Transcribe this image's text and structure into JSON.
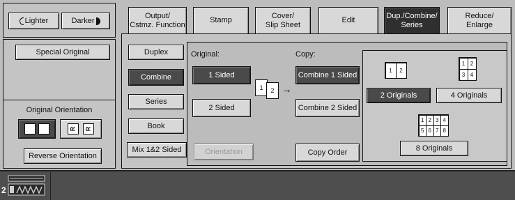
{
  "density": {
    "lighter": "Lighter",
    "darker": "Darker"
  },
  "left": {
    "special_original": "Special Original",
    "orientation_title": "Original Orientation",
    "reverse_orientation": "Reverse Orientation",
    "orient_glyph": "R"
  },
  "tabs": [
    {
      "label": "Output/\nCstmz. Function"
    },
    {
      "label": "Stamp"
    },
    {
      "label": "Cover/\nSlip Sheet"
    },
    {
      "label": "Edit"
    },
    {
      "label": "Dup./Combine/\nSeries"
    },
    {
      "label": "Reduce/\nEnlarge"
    }
  ],
  "modes": [
    "Duplex",
    "Combine",
    "Series",
    "Book",
    "Mix 1&2 Sided"
  ],
  "original": {
    "title": "Original:",
    "one_sided": "1 Sided",
    "two_sided": "2 Sided",
    "orientation": "Orientation",
    "icon_pages": [
      "1",
      "2"
    ]
  },
  "copy": {
    "title": "Copy:",
    "combine_one": "Combine 1 Sided",
    "combine_two": "Combine 2 Sided",
    "copy_order": "Copy Order",
    "arrow": "→"
  },
  "combine": {
    "two_originals": "2 Originals",
    "four_originals": "4 Originals",
    "eight_originals": "8 Originals",
    "icon_two": [
      "1",
      "2"
    ],
    "icon_four": [
      "1",
      "2",
      "3",
      "4"
    ],
    "icon_eight": [
      "1",
      "2",
      "3",
      "4",
      "5",
      "6",
      "7",
      "8"
    ]
  },
  "status": {
    "tray_number": "2"
  },
  "colors": {
    "background": "#bdbdbd",
    "selected": "#4a4a4a",
    "active_tab": "#2f2f2f",
    "status_bar": "#4e4e4e"
  }
}
